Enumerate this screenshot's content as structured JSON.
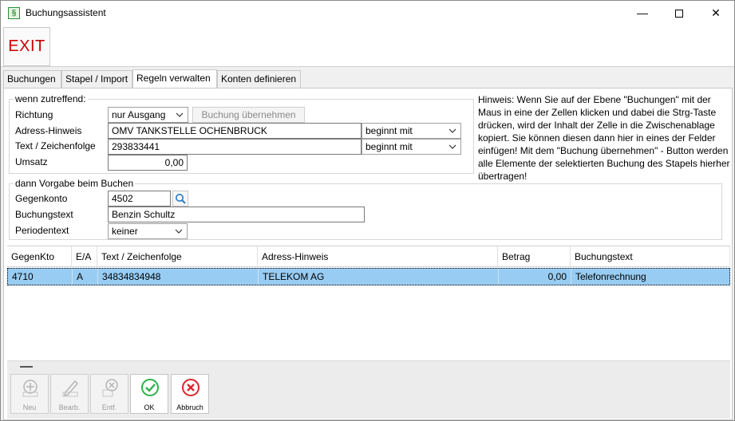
{
  "window": {
    "title": "Buchungsassistent",
    "minimize": "—",
    "close": "✕"
  },
  "toolbar": {
    "exit_label": "EXIT"
  },
  "tabs": [
    {
      "label": "Buchungen"
    },
    {
      "label": "Stapel / Import"
    },
    {
      "label": "Regeln verwalten"
    },
    {
      "label": "Konten definieren"
    }
  ],
  "conditions": {
    "legend": "wenn zutreffend:",
    "richtung_label": "Richtung",
    "richtung_value": "nur Ausgang",
    "apply_button": "Buchung übernehmen",
    "adress_label": "Adress-Hinweis",
    "adress_value": "OMV TANKSTELLE OCHENBRUCK",
    "adress_match": "beginnt mit",
    "text_label": "Text / Zeichenfolge",
    "text_value": "293833441",
    "text_match": "beginnt mit",
    "umsatz_label": "Umsatz",
    "umsatz_value": "0,00"
  },
  "hint": "Hinweis: Wenn Sie auf der Ebene \"Buchungen\" mit der Maus in eine der Zellen klicken und dabei die Strg-Taste drücken, wird der Inhalt der Zelle in die Zwischenablage kopiert. Sie können diesen dann hier in eines der Felder einfügen! Mit dem \"Buchung übernehmen\" - Button werden alle Elemente der selektierten Buchung des Stapels hierher übertragen!",
  "defaults": {
    "legend": "dann Vorgabe beim Buchen",
    "gegenkonto_label": "Gegenkonto",
    "gegenkonto_value": "4502",
    "buchungstext_label": "Buchungstext",
    "buchungstext_value": "Benzin Schultz",
    "periodentext_label": "Periodentext",
    "periodentext_value": "keiner"
  },
  "grid": {
    "columns": [
      "GegenKto",
      "E/A",
      "Text / Zeichenfolge",
      "Adress-Hinweis",
      "Betrag",
      "Buchungstext"
    ],
    "rows": [
      [
        "4710",
        "A",
        "34834834948",
        "TELEKOM AG",
        "0,00",
        "Telefonrechnung"
      ]
    ]
  },
  "actions": [
    {
      "label": "Neu",
      "icon": "plus-circle-icon",
      "enabled": false
    },
    {
      "label": "Bearb.",
      "icon": "pencil-icon",
      "enabled": false
    },
    {
      "label": "Entf.",
      "icon": "delete-circle-icon",
      "enabled": false
    },
    {
      "label": "OK",
      "icon": "check-circle-icon",
      "enabled": true
    },
    {
      "label": "Abbruch",
      "icon": "cancel-circle-icon",
      "enabled": true
    }
  ],
  "colors": {
    "exit": "#cc0000",
    "selection": "#99ccf2",
    "ok": "#2db14a",
    "cancel": "#d9262c"
  }
}
